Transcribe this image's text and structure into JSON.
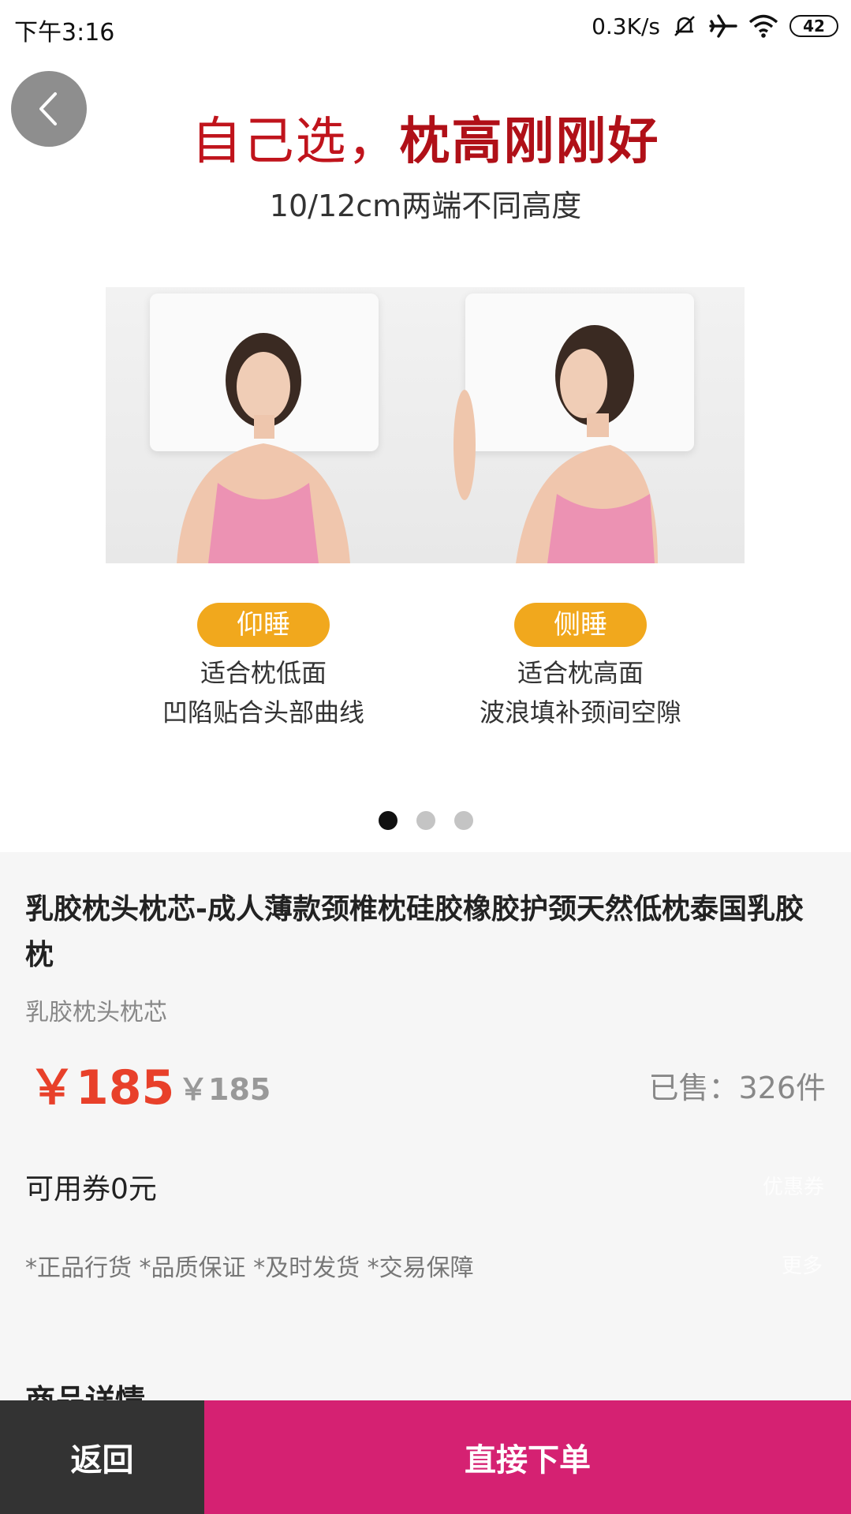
{
  "status_bar": {
    "time": "下午3:16",
    "network_speed": "0.3K/s",
    "battery_level": "42",
    "icons": [
      "mute-icon",
      "airplane-icon",
      "wifi-icon",
      "battery-icon"
    ]
  },
  "hero": {
    "title_light": "自己选，",
    "title_bold": "枕高刚刚好",
    "subtitle": "10/12cm两端不同高度",
    "left_pose": {
      "tag": "仰睡",
      "line1": "适合枕低面",
      "line2": "凹陷贴合头部曲线"
    },
    "right_pose": {
      "tag": "侧睡",
      "line1": "适合枕高面",
      "line2": "波浪填补颈间空隙"
    },
    "carousel": {
      "total": 3,
      "active_index": 0
    }
  },
  "product": {
    "title": "乳胶枕头枕芯-成人薄款颈椎枕硅胶橡胶护颈天然低枕泰国乳胶枕",
    "subtitle": "乳胶枕头枕芯",
    "price": "￥185",
    "original_price": "￥185",
    "sold": "已售：326件",
    "coupon": "可用券0元",
    "coupon_link": "优惠券",
    "guarantees": "*正品行货  *品质保证  *及时发货  *交易保障",
    "more_link": "更多",
    "detail_heading": "商品详情"
  },
  "bottom_bar": {
    "back_label": "返回",
    "order_label": "直接下单"
  },
  "colors": {
    "price_red": "#e8402a",
    "order_button": "#d52172",
    "back_button": "#333333",
    "tag_orange": "#f1a81d",
    "title_red": "#c0141c"
  }
}
